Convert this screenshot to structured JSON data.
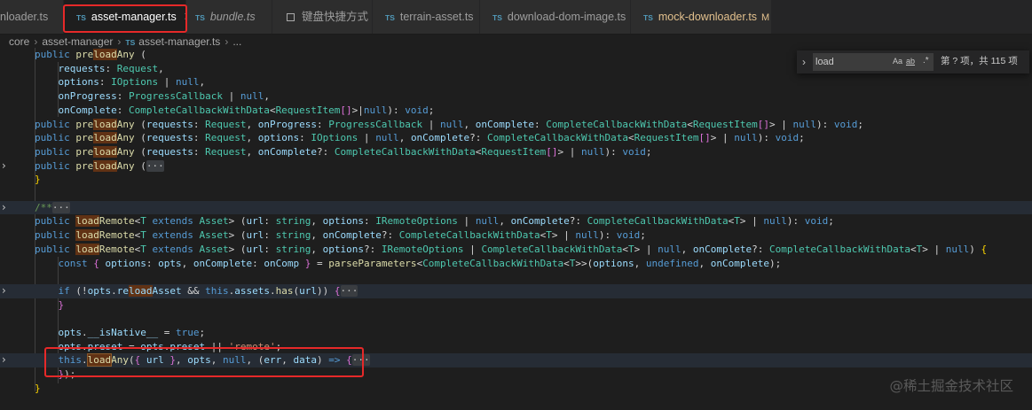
{
  "tabs": [
    {
      "label": "nloader.ts",
      "has_ts_icon": false
    },
    {
      "label": "asset-manager.ts",
      "has_ts_icon": true,
      "active": true,
      "close": "✕"
    },
    {
      "label": "bundle.ts",
      "has_ts_icon": true,
      "italic": true
    },
    {
      "label": "键盘快捷方式",
      "has_ts_icon": false,
      "grid_icon": true
    },
    {
      "label": "terrain-asset.ts",
      "has_ts_icon": true
    },
    {
      "label": "download-dom-image.ts",
      "has_ts_icon": true
    },
    {
      "label": "mock-downloader.ts",
      "has_ts_icon": true,
      "modified_flag": "M"
    }
  ],
  "ts_badge": "TS",
  "breadcrumb": {
    "items": [
      "core",
      "asset-manager",
      "asset-manager.ts",
      "..."
    ],
    "separator": "›"
  },
  "find_widget": {
    "chevron": "›",
    "query": "load",
    "match_case": "Aa",
    "whole_word": "ab",
    "regex": ".*",
    "result": "第 ? 项，共 115 项"
  },
  "code_lines": [
    "    public preloadAny (",
    "        requests: Request,",
    "        options: IOptions | null,",
    "        onProgress: ProgressCallback | null,",
    "        onComplete: CompleteCallbackWithData<RequestItem[]>|null): void;",
    "    public preloadAny (requests: Request, onProgress: ProgressCallback | null, onComplete: CompleteCallbackWithData<RequestItem[]> | null): void;",
    "    public preloadAny (requests: Request, options: IOptions | null, onComplete?: CompleteCallbackWithData<RequestItem[]> | null): void;",
    "    public preloadAny (requests: Request, onComplete?: CompleteCallbackWithData<RequestItem[]> | null): void;",
    "    public preloadAny (···",
    "    }",
    "",
    "    /**···",
    "    public loadRemote<T extends Asset> (url: string, options: IRemoteOptions | null, onComplete?: CompleteCallbackWithData<T> | null): void;",
    "    public loadRemote<T extends Asset> (url: string, onComplete?: CompleteCallbackWithData<T> | null): void;",
    "    public loadRemote<T extends Asset> (url: string, options?: IRemoteOptions | CompleteCallbackWithData<T> | null, onComplete?: CompleteCallbackWithData<T> | null) {",
    "        const { options: opts, onComplete: onComp } = parseParameters<CompleteCallbackWithData<T>>(options, undefined, onComplete);",
    "",
    "        if (!opts.reloadAsset && this.assets.has(url)) {···",
    "        }",
    "",
    "        opts.__isNative__ = true;",
    "        opts.preset = opts.preset || 'remote';",
    "        this.loadAny({ url }, opts, null, (err, data) => {···",
    "        });",
    "    }"
  ],
  "watermark": "@稀土掘金技术社区",
  "colors": {
    "editor_bg": "#1e1e1e",
    "keyword": "#569cd6",
    "function": "#dcdcaa",
    "type": "#4ec9b0",
    "param": "#9cdcfe",
    "string": "#ce9178",
    "comment": "#6a9955",
    "highlight_box": "#e62929"
  }
}
